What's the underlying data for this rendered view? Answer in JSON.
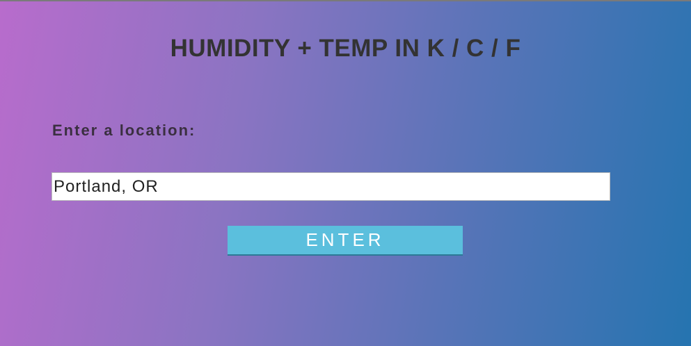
{
  "header": {
    "title": "HUMIDITY + TEMP IN K / C / F"
  },
  "form": {
    "location_label": "Enter a location:",
    "location_value": "Portland, OR",
    "submit_label": "ENTER"
  },
  "colors": {
    "gradient_start": "#b86ccc",
    "gradient_end": "#2574b0",
    "button": "#5bbfdd"
  }
}
